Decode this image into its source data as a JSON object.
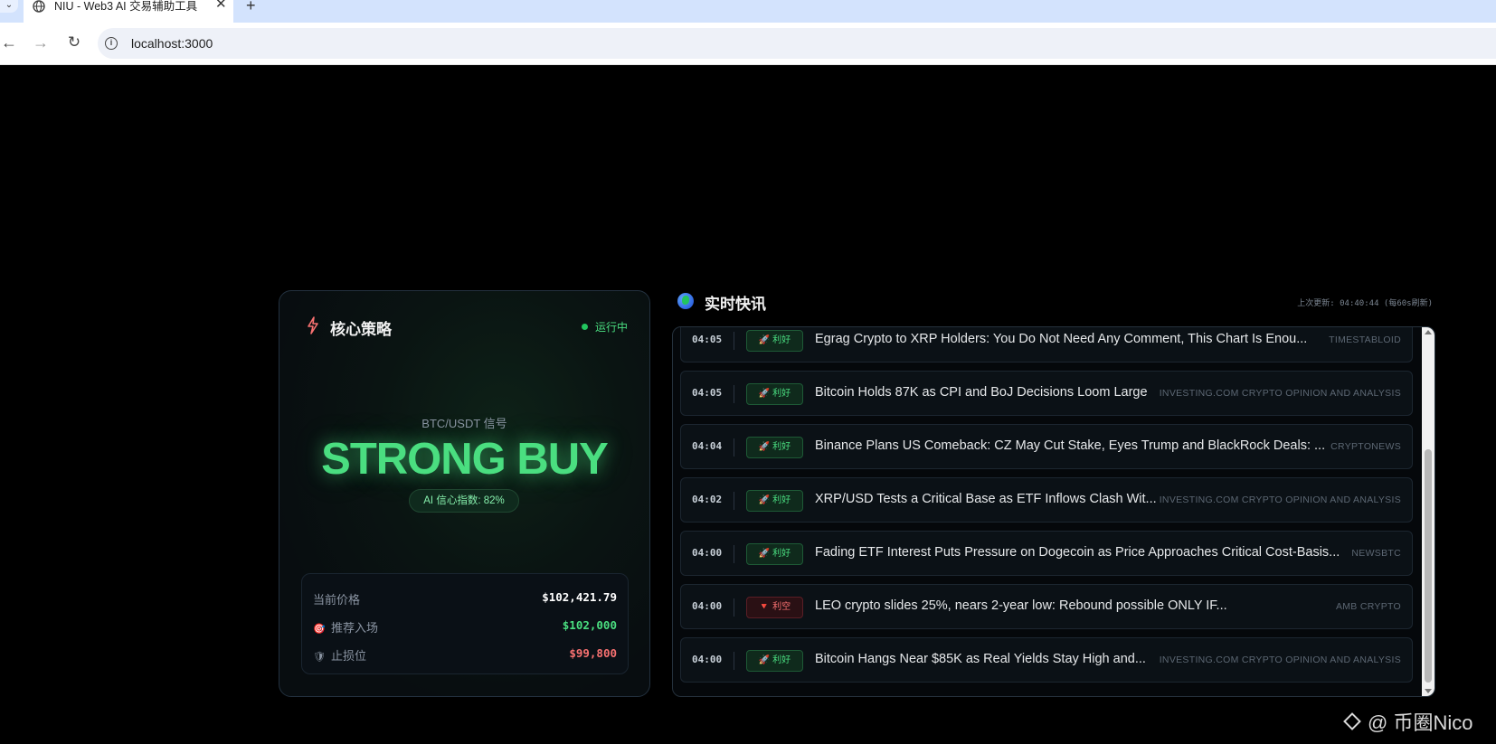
{
  "browser": {
    "tab_title": "NIU - Web3 AI 交易辅助工具",
    "tab_close": "✕",
    "new_tab": "+",
    "url": "localhost:3000"
  },
  "strategy": {
    "title": "核心策略",
    "status": "运行中",
    "pair_label": "BTC/USDT 信号",
    "signal": "STRONG BUY",
    "confidence": "AI 信心指数: 82%",
    "prices": [
      {
        "label": "当前价格",
        "icon": "",
        "value": "$102,421.79"
      },
      {
        "label": "推荐入场",
        "icon": "target-icon",
        "value": "$102,000"
      },
      {
        "label": "止损位",
        "icon": "shield-icon",
        "value": "$99,800"
      }
    ],
    "accent_color": "#4ade80"
  },
  "news": {
    "title": "实时快讯",
    "updated": "上次更新: 04:40:44 (每60s刷新)",
    "items": [
      {
        "time": "04:05",
        "badge": "🚀 利好",
        "sentiment": "bull",
        "headline": "Egrag Crypto to XRP Holders: You Do Not Need Any Comment, This Chart Is Enou...",
        "source": "TIMESTABLOID"
      },
      {
        "time": "04:05",
        "badge": "🚀 利好",
        "sentiment": "bull",
        "headline": "Bitcoin Holds 87K as CPI and BoJ Decisions Loom Large",
        "source": "INVESTING.COM CRYPTO OPINION AND ANALYSIS"
      },
      {
        "time": "04:04",
        "badge": "🚀 利好",
        "sentiment": "bull",
        "headline": "Binance Plans US Comeback: CZ May Cut Stake, Eyes Trump and BlackRock Deals: ...",
        "source": "CRYPTONEWS"
      },
      {
        "time": "04:02",
        "badge": "🚀 利好",
        "sentiment": "bull",
        "headline": "XRP/USD Tests a Critical Base as ETF Inflows Clash Wit...",
        "source": "INVESTING.COM CRYPTO OPINION AND ANALYSIS"
      },
      {
        "time": "04:00",
        "badge": "🚀 利好",
        "sentiment": "bull",
        "headline": "Fading ETF Interest Puts Pressure on Dogecoin as Price Approaches Critical Cost-Basis...",
        "source": "NEWSBTC"
      },
      {
        "time": "04:00",
        "badge": "🔻 利空",
        "sentiment": "bear",
        "headline": "LEO crypto slides 25%, nears 2-year low: Rebound possible ONLY IF...",
        "source": "AMB CRYPTO"
      },
      {
        "time": "04:00",
        "badge": "🚀 利好",
        "sentiment": "bull",
        "headline": "Bitcoin Hangs Near $85K as Real Yields Stay High and...",
        "source": "INVESTING.COM CRYPTO OPINION AND ANALYSIS"
      }
    ]
  },
  "watermark": "@ 币圈Nico"
}
